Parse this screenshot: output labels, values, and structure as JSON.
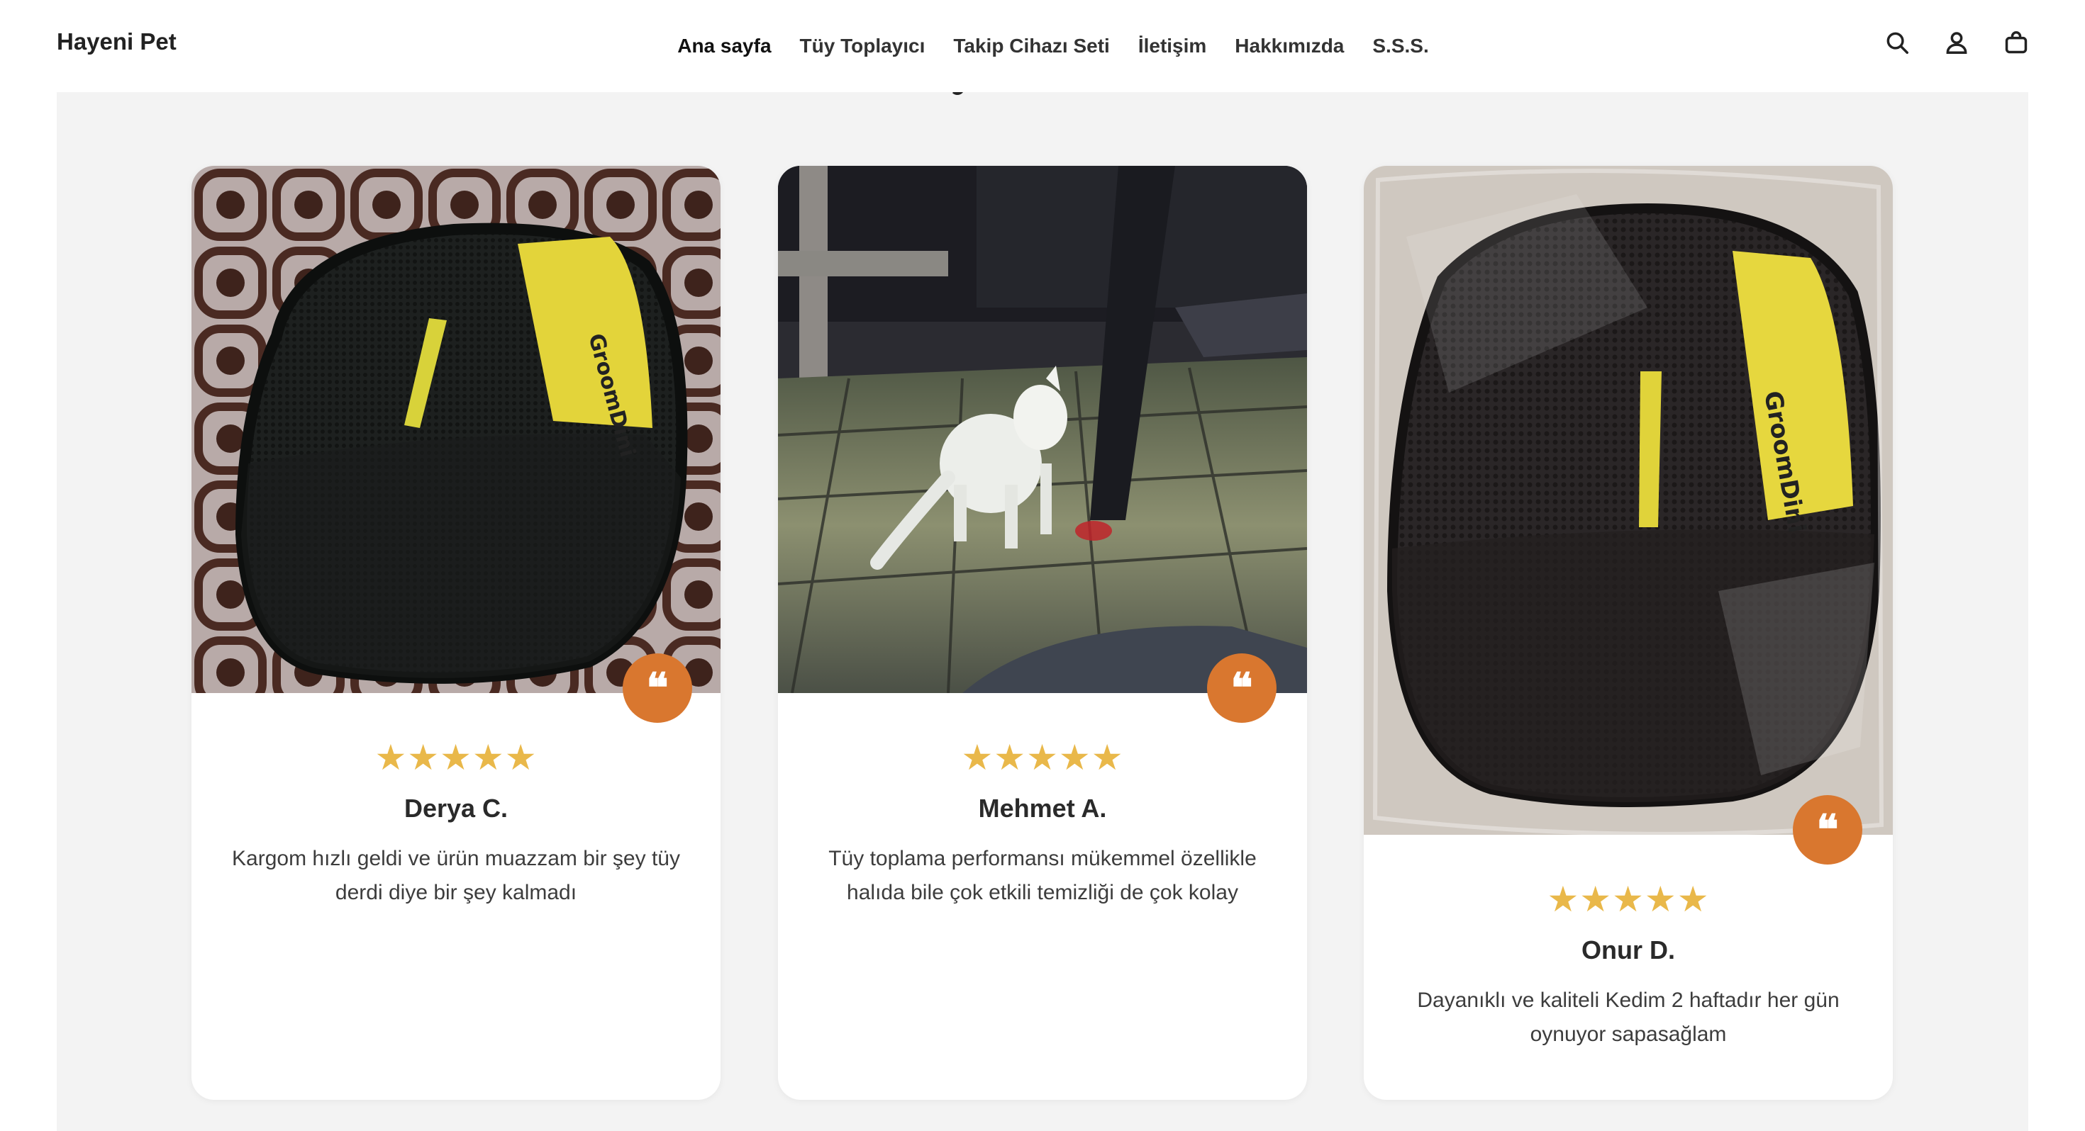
{
  "header": {
    "brand": "Hayeni Pet",
    "nav": [
      {
        "label": "Ana sayfa"
      },
      {
        "label": "Tüy Toplayıcı"
      },
      {
        "label": "Takip Cihazı Seti"
      },
      {
        "label": "İletişim"
      },
      {
        "label": "Hakkımızda"
      },
      {
        "label": "S.S.S."
      }
    ],
    "icons": [
      "search-icon",
      "account-icon",
      "cart-bag-icon"
    ]
  },
  "reviews": [
    {
      "stars": "★★★★★",
      "rating": 5,
      "name": "Derya C.",
      "text": "Kargom hızlı geldi ve ürün muazzam bir şey tüy derdi diye bir şey kalmadı",
      "photo": "black-mesh-grooming-glove-on-patterned-rug"
    },
    {
      "stars": "★★★★★",
      "rating": 5,
      "name": "Mehmet A.",
      "text": "Tüy toplama performansı mükemmel özellikle halıda bile çok etkili temizliği de çok kolay",
      "photo": "white-cat-on-tiled-floor"
    },
    {
      "stars": "★★★★★",
      "rating": 5,
      "name": "Onur D.",
      "text": "Dayanıklı ve kaliteli Kedim 2 haftadır her gün oynuyor sapasağlam",
      "photo": "grooming-glove-in-plastic-packaging"
    }
  ],
  "glove_label": "GroomDini",
  "quote_glyph": "❝",
  "colors": {
    "accent": "#d9772f",
    "star": "#e9b84a",
    "section_bg": "#f3f3f3"
  }
}
